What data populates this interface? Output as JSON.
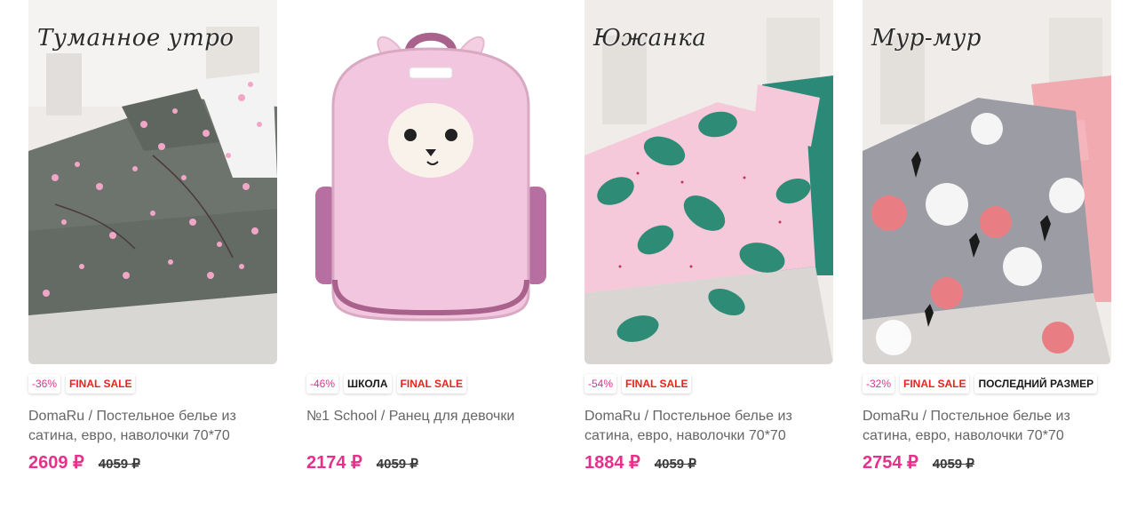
{
  "currency": "₽",
  "products": [
    {
      "script_title": "Туманное утро",
      "badges": [
        "-36%",
        "FINAL SALE"
      ],
      "title": "DomaRu / Постельное белье из сатина, евро, наволочки 70*70",
      "price": "2609 ₽",
      "old_price": "4059 ₽",
      "image_icon": "bedding-sakura-icon",
      "colors": {
        "fabric": "#6d736d",
        "flower": "#f2a6c7",
        "bg": "#efece9"
      }
    },
    {
      "script_title": "",
      "badges": [
        "-46%",
        "ШКОЛА",
        "FINAL SALE"
      ],
      "title": "№1 School / Ранец для девочки",
      "price": "2174 ₽",
      "old_price": "4059 ₽",
      "image_icon": "backpack-llama-icon",
      "colors": {
        "body": "#f2c6de",
        "trim": "#a8628c",
        "bg": "#ffffff"
      }
    },
    {
      "script_title": "Южанка",
      "badges": [
        "-54%",
        "FINAL SALE"
      ],
      "title": "DomaRu / Постельное белье из сатина, евро, наволочки 70*70",
      "price": "1884 ₽",
      "old_price": "4059 ₽",
      "image_icon": "bedding-monstera-icon",
      "colors": {
        "fabric": "#f5c9da",
        "leaf": "#2e8b75",
        "accent": "#2a8a77",
        "bg": "#efece9"
      }
    },
    {
      "script_title": "Мур-мур",
      "badges": [
        "-32%",
        "FINAL SALE",
        "ПОСЛЕДНИЙ РАЗМЕР"
      ],
      "title": "DomaRu / Постельное белье из сатина, евро, наволочки 70*70",
      "price": "2754 ₽",
      "old_price": "4059 ₽",
      "image_icon": "bedding-cats-icon",
      "colors": {
        "fabric": "#9c9ca4",
        "accent": "#f0aab0",
        "bg": "#efece9"
      }
    }
  ]
}
